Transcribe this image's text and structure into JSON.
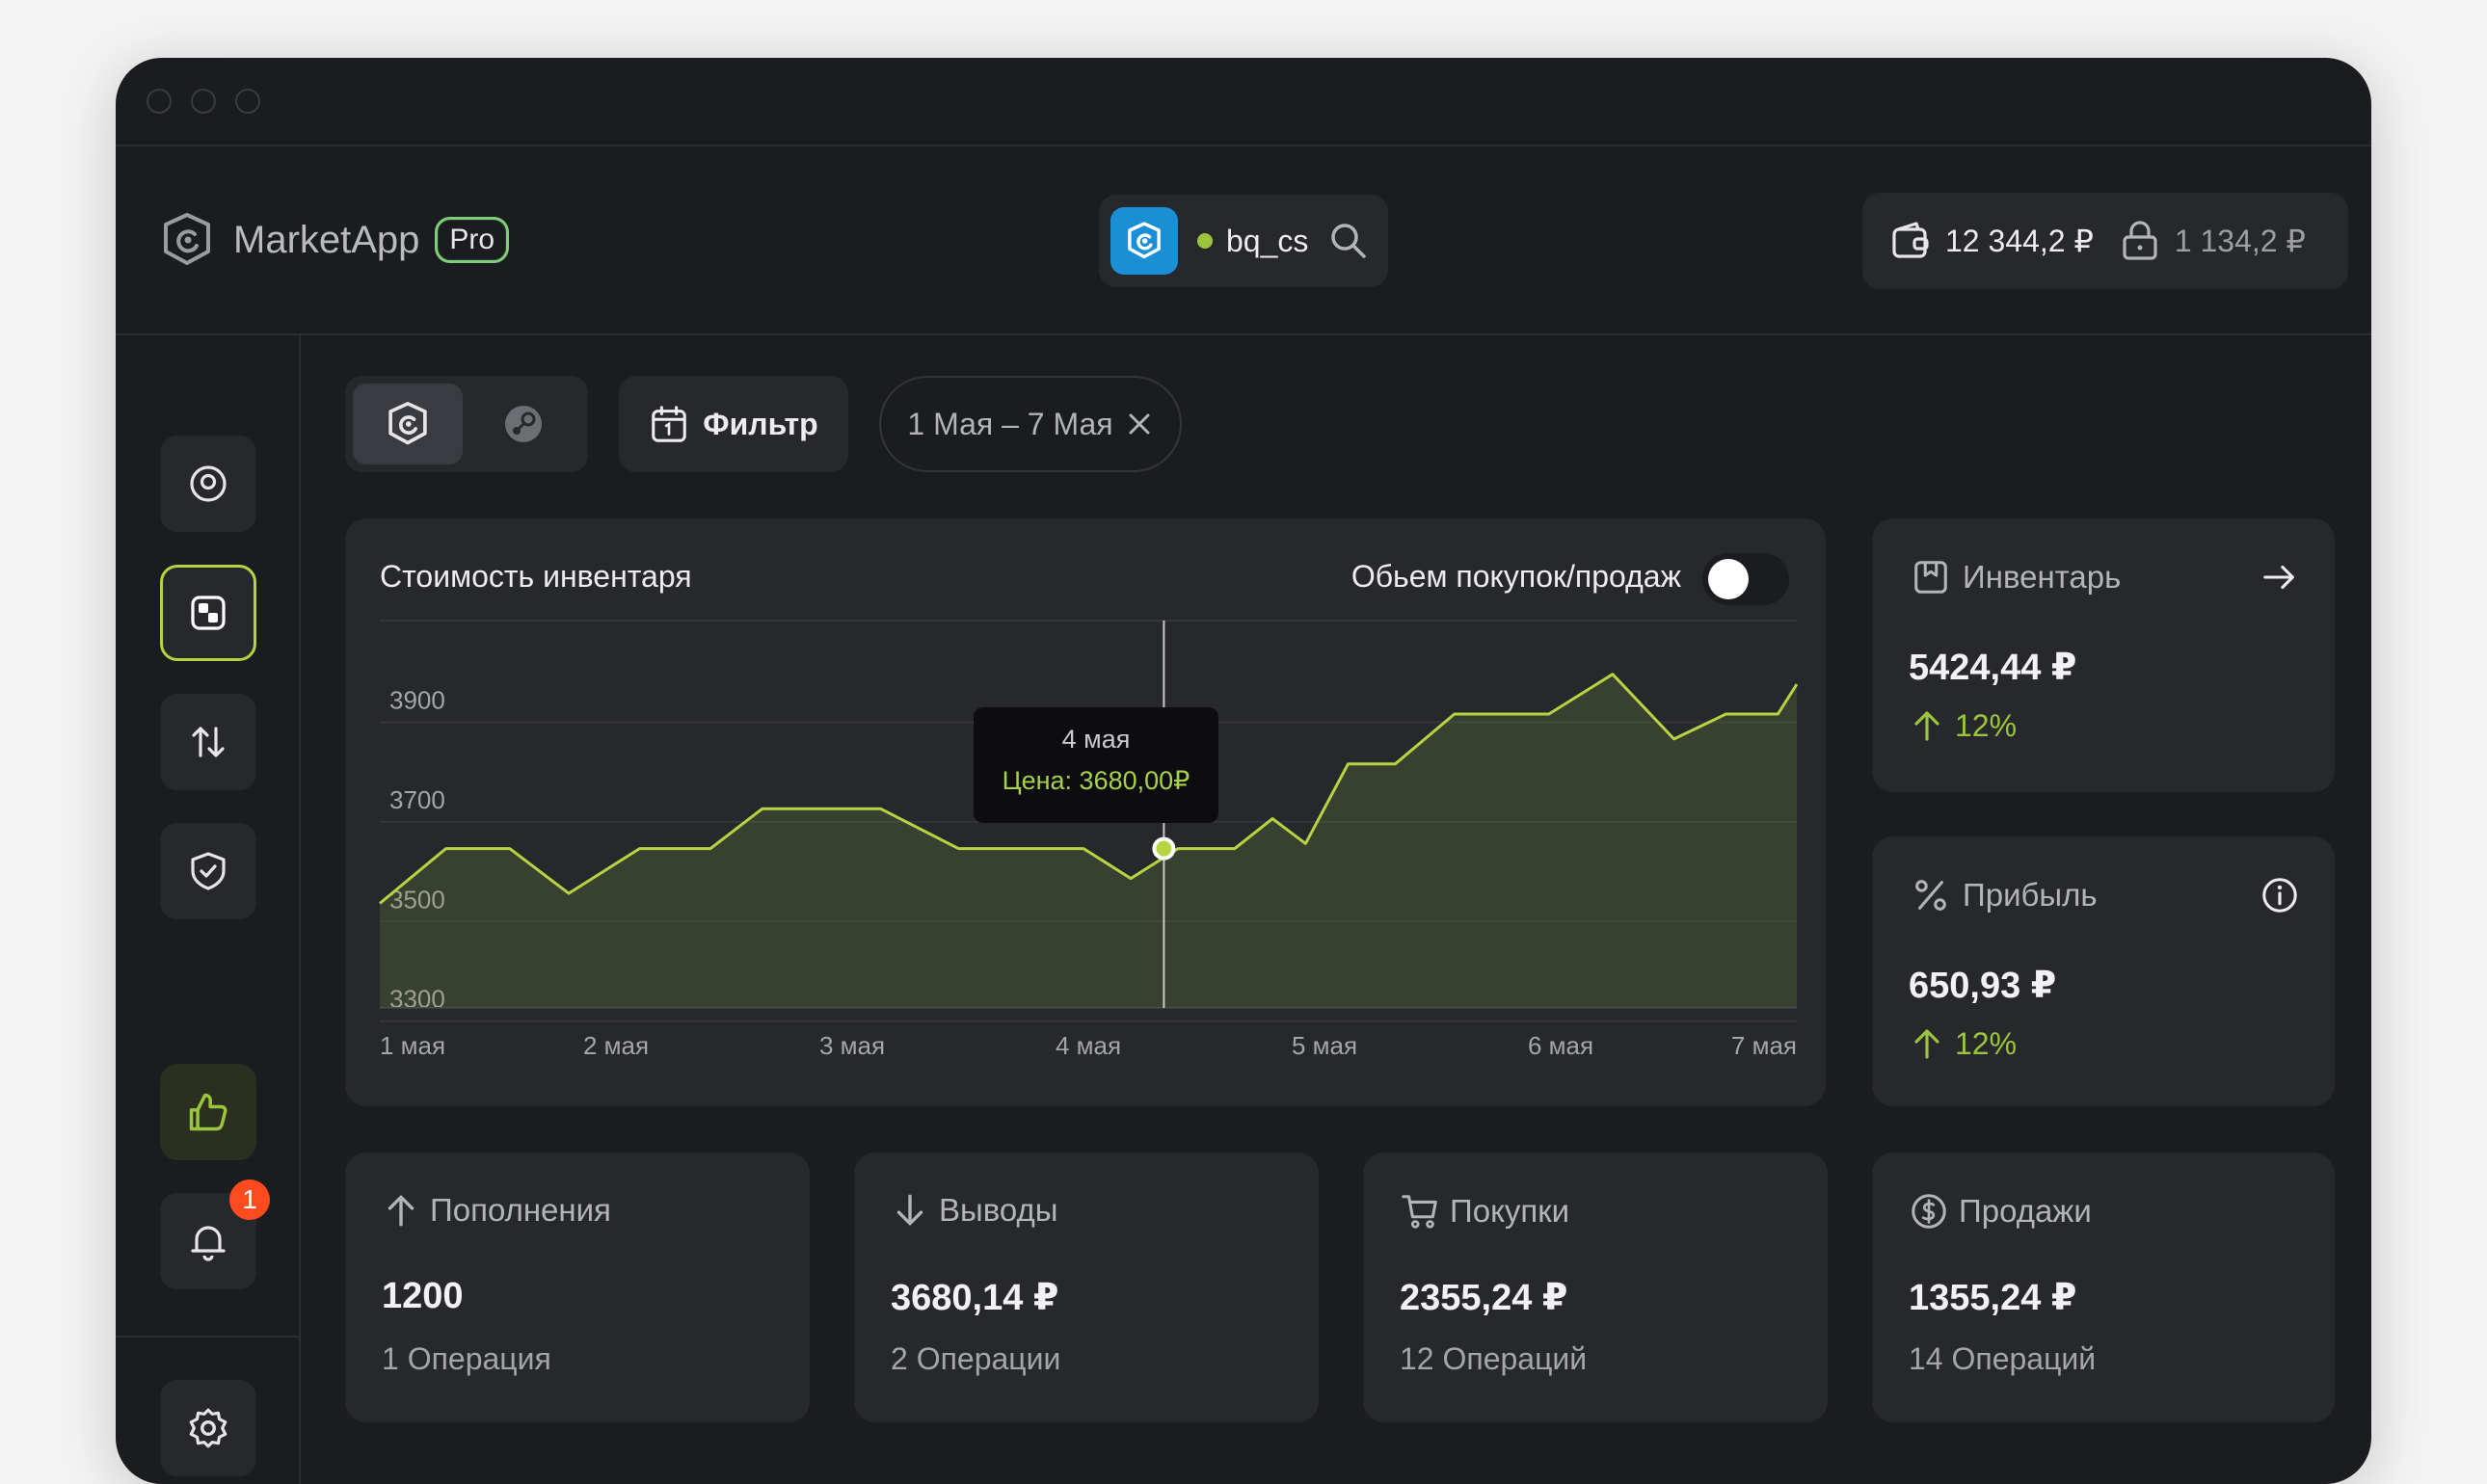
{
  "app": {
    "name": "MarketApp",
    "tier": "Pro"
  },
  "user": {
    "name": "bq_cs",
    "status_color": "#9bc53d"
  },
  "balances": {
    "wallet": "12 344,2 ₽",
    "locked": "1 134,2 ₽"
  },
  "sidebar": {
    "items": [
      {
        "icon": "user-circle-icon"
      },
      {
        "icon": "dashboard-icon",
        "active": true
      },
      {
        "icon": "transfer-icon"
      },
      {
        "icon": "shield-check-icon"
      },
      {
        "icon": "thumbs-up-icon"
      },
      {
        "icon": "bell-icon",
        "badge": "1"
      },
      {
        "icon": "gear-icon"
      }
    ]
  },
  "filters": {
    "filter_label": "Фильтр",
    "date_range": "1 Мая – 7 Мая"
  },
  "chart_card": {
    "title": "Стоимость инвентаря",
    "toggle_label": "Обьем покупок/продаж",
    "tooltip": {
      "date": "4 мая",
      "price": "Цена: 3680,00₽"
    }
  },
  "chart_data": {
    "type": "area",
    "title": "Стоимость инвентаря",
    "x_tick_labels": [
      "1 мая",
      "2 мая",
      "3 мая",
      "4 мая",
      "5 мая",
      "6 мая",
      "7 мая"
    ],
    "y_tick_labels": [
      "3900",
      "3700",
      "3500",
      "3300"
    ],
    "y_ticks": [
      3900,
      3700,
      3500,
      3300
    ],
    "ylim": [
      3280,
      4050
    ],
    "xlim": [
      0,
      6
    ],
    "grid": true,
    "line_color": "#b8d341",
    "series": [
      {
        "points": [
          [
            0.0,
            3490
          ],
          [
            0.28,
            3600
          ],
          [
            0.55,
            3600
          ],
          [
            0.8,
            3510
          ],
          [
            1.1,
            3600
          ],
          [
            1.4,
            3600
          ],
          [
            1.62,
            3680
          ],
          [
            1.9,
            3680
          ],
          [
            2.12,
            3680
          ],
          [
            2.45,
            3600
          ],
          [
            2.78,
            3600
          ],
          [
            2.98,
            3600
          ],
          [
            3.18,
            3540
          ],
          [
            3.38,
            3600
          ],
          [
            3.62,
            3600
          ],
          [
            3.78,
            3660
          ],
          [
            3.92,
            3610
          ],
          [
            4.1,
            3770
          ],
          [
            4.3,
            3770
          ],
          [
            4.55,
            3870
          ],
          [
            4.95,
            3870
          ],
          [
            5.22,
            3950
          ],
          [
            5.48,
            3820
          ],
          [
            5.7,
            3870
          ],
          [
            5.92,
            3870
          ],
          [
            6.0,
            3930
          ]
        ]
      }
    ],
    "highlight": {
      "x": 3.32,
      "y": 3600,
      "label": "4 мая",
      "value": "Цена: 3680,00₽"
    }
  },
  "side_cards": [
    {
      "title": "Инвентарь",
      "value": "5424,44 ₽",
      "change": "12%"
    },
    {
      "title": "Прибыль",
      "value": "650,93 ₽",
      "change": "12%"
    }
  ],
  "stats": [
    {
      "title": "Пополнения",
      "value": "1200",
      "sub": "1 Операция"
    },
    {
      "title": "Выводы",
      "value": "3680,14 ₽",
      "sub": "2 Операции"
    },
    {
      "title": "Покупки",
      "value": "2355,24 ₽",
      "sub": "12 Операций"
    },
    {
      "title": "Продажи",
      "value": "1355,24 ₽",
      "sub": "14 Операций"
    }
  ]
}
